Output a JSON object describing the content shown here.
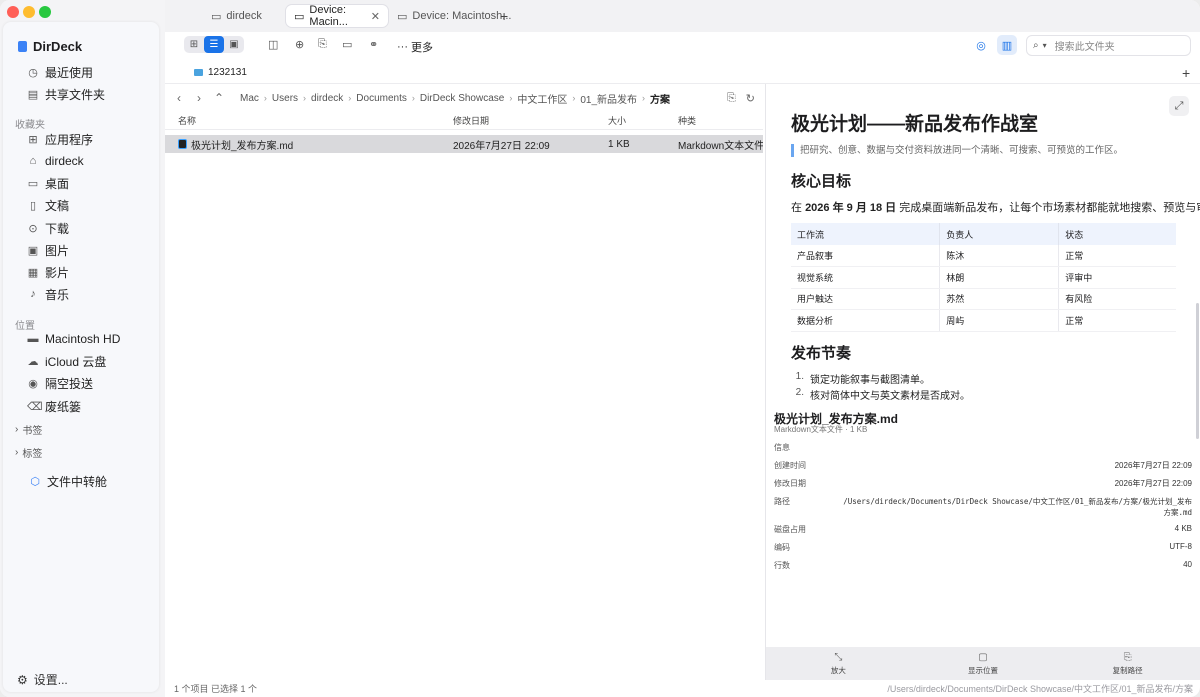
{
  "app": {
    "name": "DirDeck"
  },
  "sidebar": {
    "top_items": [
      {
        "label": "最近使用",
        "icon": "clock-icon"
      },
      {
        "label": "共享文件夹",
        "icon": "shared-folder-icon"
      }
    ],
    "favorites_title": "收藏夹",
    "favorites": [
      {
        "label": "应用程序",
        "icon": "apps-icon"
      },
      {
        "label": "dirdeck",
        "icon": "home-icon"
      },
      {
        "label": "桌面",
        "icon": "desktop-icon"
      },
      {
        "label": "文稿",
        "icon": "document-icon"
      },
      {
        "label": "下载",
        "icon": "download-icon"
      },
      {
        "label": "图片",
        "icon": "image-icon"
      },
      {
        "label": "影片",
        "icon": "film-icon"
      },
      {
        "label": "音乐",
        "icon": "music-icon"
      }
    ],
    "locations_title": "位置",
    "locations": [
      {
        "label": "Macintosh HD",
        "icon": "disk-icon"
      },
      {
        "label": "iCloud 云盘",
        "icon": "cloud-icon"
      },
      {
        "label": "隔空投送",
        "icon": "airdrop-icon"
      },
      {
        "label": "废纸篓",
        "icon": "trash-icon"
      }
    ],
    "bookmarks": "书签",
    "tags": "标签",
    "transfer": "文件中转舱",
    "settings": "设置..."
  },
  "tabs": [
    {
      "label": "dirdeck"
    },
    {
      "label": "Device: Macin..."
    },
    {
      "label": "Device: Macintosh..."
    }
  ],
  "toolbar": {
    "more": "更多",
    "search_placeholder": "搜索此文件夹"
  },
  "folder_tab": "1232131",
  "breadcrumb": [
    "Mac",
    "Users",
    "dirdeck",
    "Documents",
    "DirDeck Showcase",
    "中文工作区",
    "01_新品发布",
    "方案"
  ],
  "file_list": {
    "columns": [
      "名称",
      "修改日期",
      "大小",
      "种类"
    ],
    "rows": [
      {
        "name": "极光计划_发布方案.md",
        "date": "2026年7月27日 22:09",
        "size": "1 KB",
        "kind": "Markdown文本文件"
      }
    ]
  },
  "status": {
    "left": "1 个项目  已选择 1 个",
    "right": "/Users/dirdeck/Documents/DirDeck Showcase/中文工作区/01_新品发布/方案"
  },
  "preview": {
    "title": "极光计划——新品发布作战室",
    "quote": "把研究、创意、数据与交付资料放进同一个清晰、可搜索、可预览的工作区。",
    "h2_goal": "核心目标",
    "goal_prefix": "在 ",
    "goal_date": "2026 年 9 月 18 日",
    "goal_suffix": " 完成桌面端新品发布，让每个市场素材都能就地搜索、预览与审核。",
    "table_head": [
      "工作流",
      "负责人",
      "状态"
    ],
    "table_rows": [
      [
        "产品叙事",
        "陈沐",
        "正常"
      ],
      [
        "视觉系统",
        "林朗",
        "评审中"
      ],
      [
        "用户触达",
        "苏然",
        "有风险"
      ],
      [
        "数据分析",
        "周屿",
        "正常"
      ]
    ],
    "h2_rhythm": "发布节奏",
    "steps": [
      {
        "n": "1.",
        "text": "锁定功能叙事与截图清单。"
      },
      {
        "n": "2.",
        "text": "核对简体中文与英文素材是否成对。"
      }
    ]
  },
  "info": {
    "name": "极光计划_发布方案.md",
    "sub": "Markdown文本文件 · 1 KB",
    "section": "信息",
    "rows": [
      {
        "k": "创建时间",
        "v": "2026年7月27日 22:09"
      },
      {
        "k": "修改日期",
        "v": "2026年7月27日 22:09"
      },
      {
        "k": "路径",
        "v": "/Users/dirdeck/Documents/DirDeck Showcase/中文工作区/01_新品发布/方案/极光计划_发布",
        "v2": "方案.md"
      },
      {
        "k": "磁盘占用",
        "v": "4 KB"
      },
      {
        "k": "编码",
        "v": "UTF-8"
      },
      {
        "k": "行数",
        "v": "40"
      }
    ]
  },
  "actions": [
    {
      "label": "放大",
      "icon": "zoom-icon"
    },
    {
      "label": "显示位置",
      "icon": "reveal-icon"
    },
    {
      "label": "复制路径",
      "icon": "copy-icon"
    }
  ],
  "colors": {
    "accent": "#1a73e8",
    "close": "#ff5f57",
    "minimize": "#febc2e",
    "zoom": "#28c840"
  }
}
